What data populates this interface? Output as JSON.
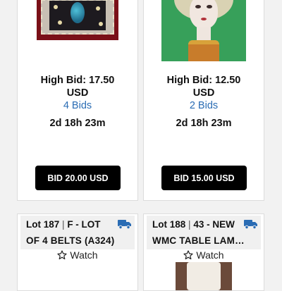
{
  "cards": [
    {
      "high_bid": "High Bid: 17.50",
      "currency": "USD",
      "bids": "4 Bids",
      "time_left": "2d 18h 23m",
      "button": "BID 20.00 USD"
    },
    {
      "high_bid": "High Bid: 12.50",
      "currency": "USD",
      "bids": "2 Bids",
      "time_left": "2d 18h 23m",
      "button": "BID 15.00 USD"
    }
  ],
  "lots": [
    {
      "lot_label": "Lot 187",
      "separator": "|",
      "title_start": "F - LOT",
      "title_cont": "OF 4 BELTS (A324)",
      "icon": "truck-icon",
      "watch": "Watch"
    },
    {
      "lot_label": "Lot 188",
      "separator": "|",
      "title_start": "43 - NEW",
      "title_cont": "WMC TABLE LAM…",
      "icon": "truck-icon",
      "watch": "Watch"
    }
  ],
  "colors": {
    "link": "#2a6cb4",
    "button_bg": "#000000",
    "truck": "#2a6cb4"
  }
}
